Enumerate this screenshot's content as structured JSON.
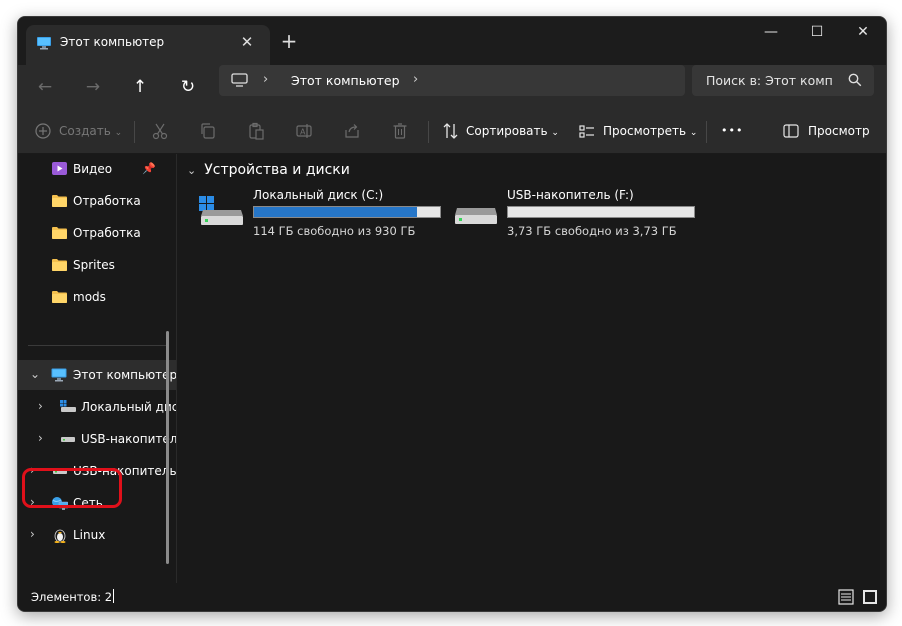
{
  "window": {
    "tab_title": "Этот компьютер",
    "tab_close": "✕",
    "new_tab": "+",
    "minimize": "—",
    "maximize": "☐",
    "close": "✕"
  },
  "nav": {
    "back": "←",
    "forward": "→",
    "up": "↑",
    "refresh": "↻",
    "address_crumb": "Этот компьютер",
    "search_placeholder": "Поиск в: Этот комп"
  },
  "toolbar": {
    "create_label": "Создать",
    "sort_label": "Сортировать",
    "view_label": "Просмотреть",
    "more_label": "•••",
    "preview_label": "Просмотр"
  },
  "sidebar": {
    "quick_access": [
      {
        "label": "Видео",
        "icon": "video-folder-icon",
        "pinned": true
      },
      {
        "label": "Отработка",
        "icon": "folder-icon"
      },
      {
        "label": "Отработка",
        "icon": "folder-icon"
      },
      {
        "label": "Sprites",
        "icon": "folder-icon"
      },
      {
        "label": "mods",
        "icon": "folder-icon"
      }
    ],
    "tree": {
      "this_pc": "Этот компьютер",
      "local_disk": "Локальный диск (C:)",
      "usb_child": "USB-накопитель (F:)",
      "usb_root": "USB-накопитель (F:)",
      "network": "Сеть",
      "linux": "Linux"
    }
  },
  "content": {
    "group_title": "Устройства и диски",
    "drives": [
      {
        "name": "Локальный диск (C:)",
        "free_text": "114 ГБ свободно из 930 ГБ",
        "used_fraction": 0.877,
        "system": true
      },
      {
        "name": "USB-накопитель (F:)",
        "free_text": "3,73 ГБ свободно из 3,73 ГБ",
        "used_fraction": 0.0,
        "system": false
      }
    ]
  },
  "status": {
    "items_count": "Элементов: 2"
  },
  "colors": {
    "accent": "#2676c8",
    "highlight": "#e0101a",
    "folder": "#f4c04e"
  }
}
